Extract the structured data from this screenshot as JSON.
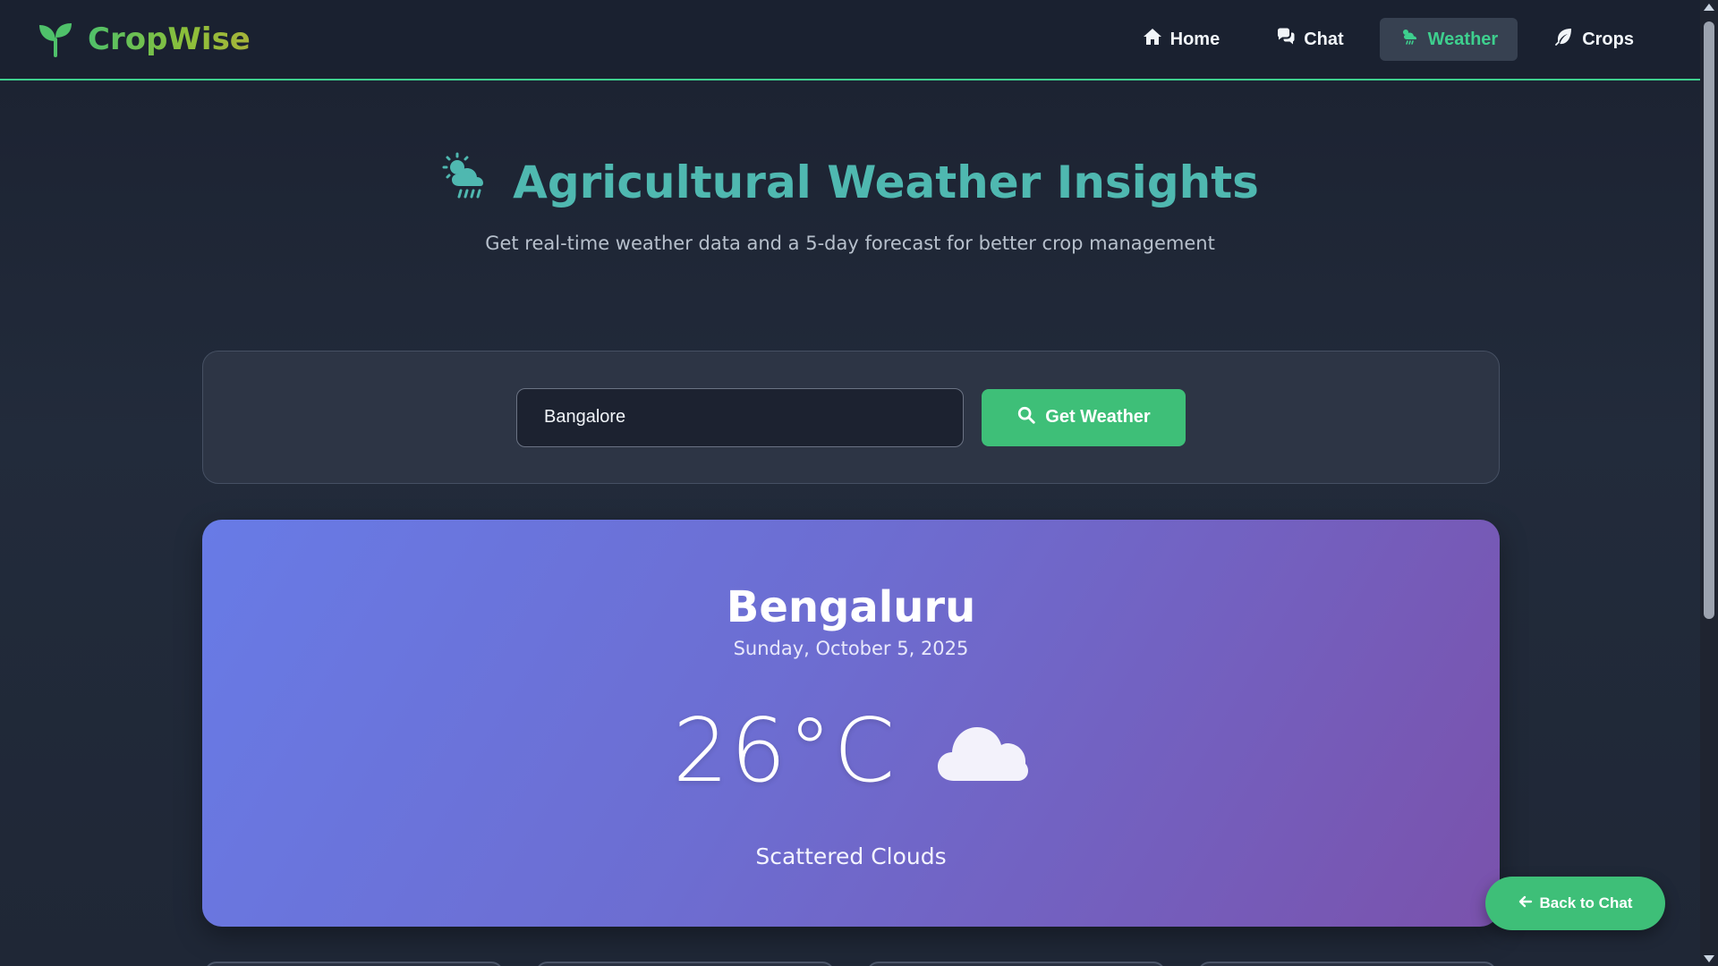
{
  "navbar": {
    "brand_name": "CropWise",
    "brand_icon": "seedling-icon",
    "links": [
      {
        "label": "Home",
        "icon": "home-icon",
        "active": false
      },
      {
        "label": "Chat",
        "icon": "comments-icon",
        "active": false
      },
      {
        "label": "Weather",
        "icon": "cloud-sun-rain-icon",
        "active": true
      },
      {
        "label": "Crops",
        "icon": "leaf-icon",
        "active": false
      }
    ]
  },
  "hero": {
    "title": "Agricultural Weather Insights",
    "title_icon": "cloud-sun-rain-icon",
    "subtitle": "Get real-time weather data and a 5-day forecast for better crop management"
  },
  "search": {
    "city_value": "Bangalore",
    "button_label": "Get Weather",
    "button_icon": "search-icon"
  },
  "weather": {
    "city": "Bengaluru",
    "date": "Sunday, October 5, 2025",
    "temperature": "26°C",
    "condition": "Scattered Clouds",
    "icon": "cloud-icon"
  },
  "floating": {
    "back_label": "Back to Chat",
    "back_icon": "arrow-left-icon"
  },
  "colors": {
    "accent": "#3ebf78",
    "nav_border": "#3ecf8e",
    "title": "#4fb8b0",
    "card_gradient_start": "#687be6",
    "card_gradient_end": "#7a52ac"
  }
}
